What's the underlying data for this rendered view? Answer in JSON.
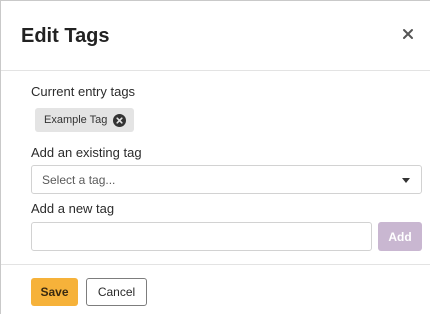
{
  "modal": {
    "title": "Edit Tags",
    "close_icon": "close-icon"
  },
  "current_tags": {
    "label": "Current entry tags",
    "tags": [
      {
        "label": "Example Tag",
        "remove_icon": "remove-tag-icon"
      }
    ]
  },
  "existing_tag": {
    "label": "Add an existing tag",
    "placeholder": "Select a tag...",
    "caret_icon": "caret-down-icon"
  },
  "new_tag": {
    "label": "Add a new tag",
    "value": "",
    "add_label": "Add"
  },
  "footer": {
    "save_label": "Save",
    "cancel_label": "Cancel"
  },
  "colors": {
    "save_button": "#f6b23a",
    "add_button_disabled": "#c9b7d1",
    "tag_chip": "#e4e4e4"
  }
}
